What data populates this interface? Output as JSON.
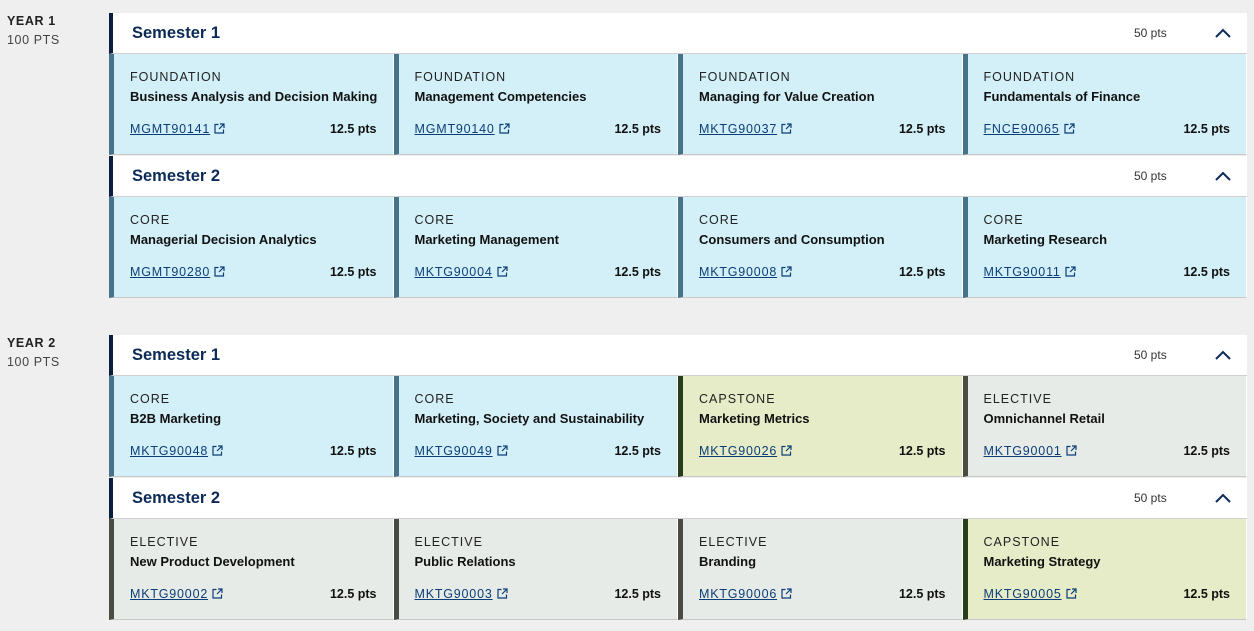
{
  "years": [
    {
      "title": "YEAR 1",
      "points": "100 PTS",
      "semesters": [
        {
          "title": "Semester 1",
          "points": "50 pts",
          "subjects": [
            {
              "type": "FOUNDATION",
              "name": "Business Analysis and Decision Making",
              "code": "MGMT90141",
              "points": "12.5 pts"
            },
            {
              "type": "FOUNDATION",
              "name": "Management Competencies",
              "code": "MGMT90140",
              "points": "12.5 pts"
            },
            {
              "type": "FOUNDATION",
              "name": "Managing for Value Creation",
              "code": "MKTG90037",
              "points": "12.5 pts"
            },
            {
              "type": "FOUNDATION",
              "name": "Fundamentals of Finance",
              "code": "FNCE90065",
              "points": "12.5 pts"
            }
          ]
        },
        {
          "title": "Semester 2",
          "points": "50 pts",
          "subjects": [
            {
              "type": "CORE",
              "name": "Managerial Decision Analytics",
              "code": "MGMT90280",
              "points": "12.5 pts"
            },
            {
              "type": "CORE",
              "name": "Marketing Management",
              "code": "MKTG90004",
              "points": "12.5 pts"
            },
            {
              "type": "CORE",
              "name": "Consumers and Consumption",
              "code": "MKTG90008",
              "points": "12.5 pts"
            },
            {
              "type": "CORE",
              "name": "Marketing Research",
              "code": "MKTG90011",
              "points": "12.5 pts"
            }
          ]
        }
      ]
    },
    {
      "title": "YEAR 2",
      "points": "100 PTS",
      "semesters": [
        {
          "title": "Semester 1",
          "points": "50 pts",
          "subjects": [
            {
              "type": "CORE",
              "name": "B2B Marketing",
              "code": "MKTG90048",
              "points": "12.5 pts"
            },
            {
              "type": "CORE",
              "name": "Marketing, Society and Sustainability",
              "code": "MKTG90049",
              "points": "12.5 pts"
            },
            {
              "type": "CAPSTONE",
              "name": "Marketing Metrics",
              "code": "MKTG90026",
              "points": "12.5 pts"
            },
            {
              "type": "ELECTIVE",
              "name": "Omnichannel Retail",
              "code": "MKTG90001",
              "points": "12.5 pts"
            }
          ]
        },
        {
          "title": "Semester 2",
          "points": "50 pts",
          "subjects": [
            {
              "type": "ELECTIVE",
              "name": "New Product Development",
              "code": "MKTG90002",
              "points": "12.5 pts"
            },
            {
              "type": "ELECTIVE",
              "name": "Public Relations",
              "code": "MKTG90003",
              "points": "12.5 pts"
            },
            {
              "type": "ELECTIVE",
              "name": "Branding",
              "code": "MKTG90006",
              "points": "12.5 pts"
            },
            {
              "type": "CAPSTONE",
              "name": "Marketing Strategy",
              "code": "MKTG90005",
              "points": "12.5 pts"
            }
          ]
        }
      ]
    }
  ],
  "icons": {
    "collapse": "chevron-up-icon",
    "external_link": "external-link-icon"
  },
  "colors": {
    "foundation_core_bg": "#d3f0f8",
    "capstone_bg": "#e6ecc7",
    "elective_bg": "#e7ebe7",
    "link": "#0b3e78",
    "semester_title": "#0b2a57"
  }
}
